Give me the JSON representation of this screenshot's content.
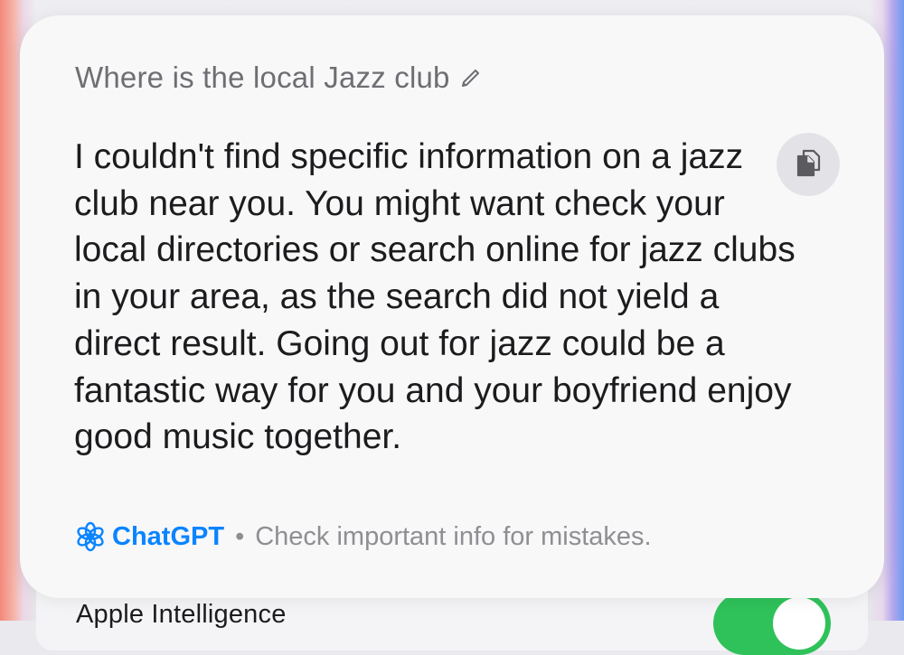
{
  "card": {
    "query": "Where is the local Jazz club",
    "answer": "I couldn't find specific information on a jazz club near you. You might want check your local directories or search online for jazz clubs in your area, as the search did not yield a direct result. Going out for jazz could be a fantastic way for you and your boyfriend enjoy good music together.",
    "footer": {
      "brand": "ChatGPT",
      "separator": "•",
      "disclaimer": "Check important info for mistakes."
    }
  },
  "underlying_setting": {
    "label": "Apple Intelligence"
  },
  "icons": {
    "edit": "pencil-icon",
    "copy": "copy-icon",
    "brand": "chatgpt-logo-icon"
  },
  "colors": {
    "brand_blue": "#0a84ff",
    "toggle_on": "#2fc25a"
  }
}
